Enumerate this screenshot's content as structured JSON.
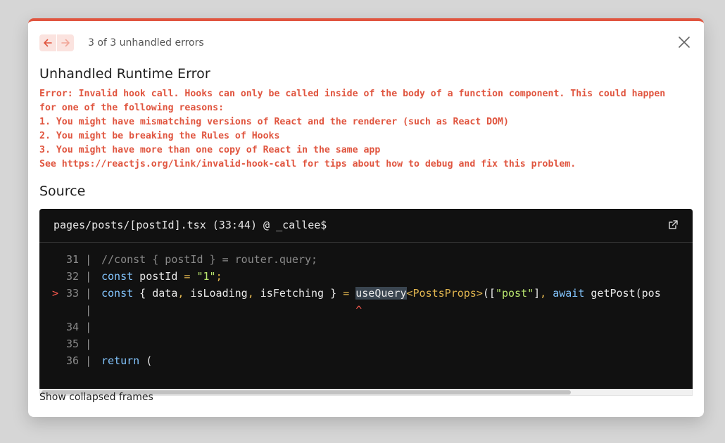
{
  "header": {
    "error_count": "3 of 3 unhandled errors"
  },
  "icons": {
    "prev": "arrow-left-icon",
    "next": "arrow-right-icon",
    "close": "close-icon",
    "external": "external-link-icon"
  },
  "error": {
    "title": "Unhandled Runtime Error",
    "message": "Error: Invalid hook call. Hooks can only be called inside of the body of a function component. This could happen for one of the following reasons:\n1. You might have mismatching versions of React and the renderer (such as React DOM)\n2. You might be breaking the Rules of Hooks\n3. You might have more than one copy of React in the same app\nSee https://reactjs.org/link/invalid-hook-call for tips about how to debug and fix this problem."
  },
  "source": {
    "heading": "Source",
    "file_location": "pages/posts/[postId].tsx (33:44) @ _callee$",
    "lines": [
      {
        "marker": "",
        "gutter": "31 |",
        "code": "//const { postId } = router.query;"
      },
      {
        "marker": "",
        "gutter": "32 |",
        "code": "const postId = \"1\";"
      },
      {
        "marker": ">",
        "gutter": "33 |",
        "code": "const { data, isLoading, isFetching } = useQuery<PostsProps>([\"post\"], await getPost(pos"
      },
      {
        "marker": "",
        "gutter": "   |",
        "code": "                                        ^"
      },
      {
        "marker": "",
        "gutter": "34 |",
        "code": ""
      },
      {
        "marker": "",
        "gutter": "35 |",
        "code": ""
      },
      {
        "marker": "",
        "gutter": "36 |",
        "code": "return ("
      }
    ]
  },
  "footer": {
    "show_collapsed": "Show collapsed frames"
  },
  "colors": {
    "accent": "#e0553f",
    "code_bg": "#111111",
    "keyword": "#84c6ff",
    "string": "#b9e66e",
    "punct": "#e2b64f"
  }
}
